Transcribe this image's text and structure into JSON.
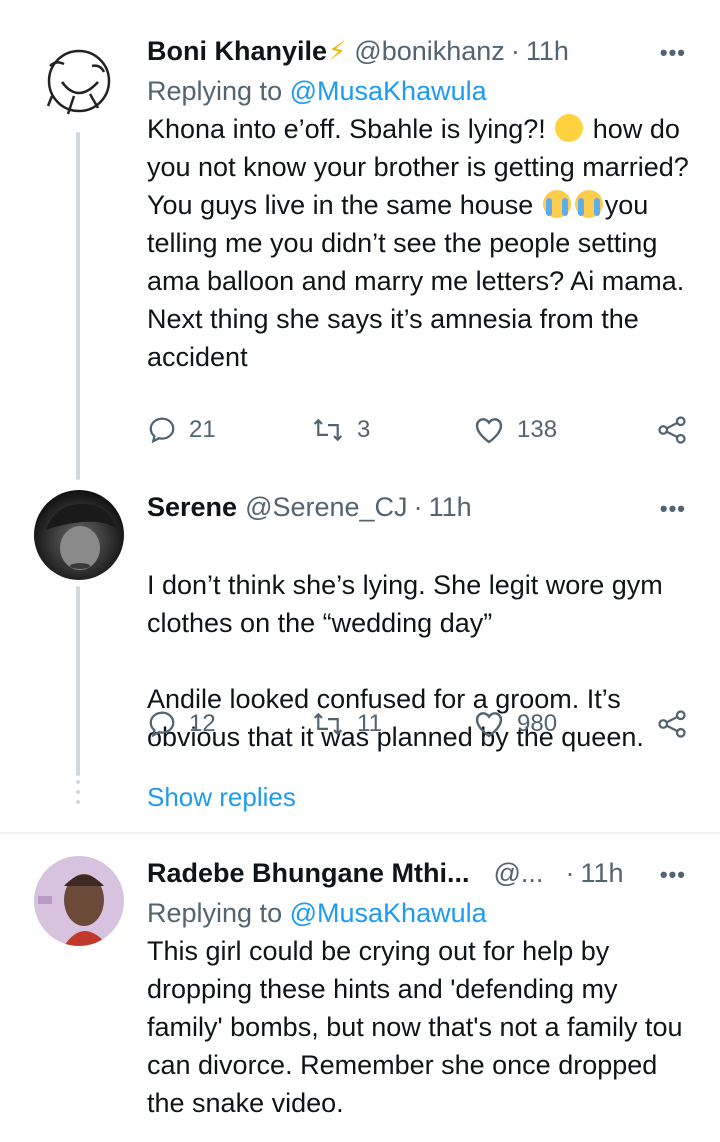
{
  "tweets": [
    {
      "name": "Boni Khanyile",
      "handle": "@bonikhanz",
      "sep": "·",
      "time": "11h",
      "replying_prefix": "Replying to",
      "replying_to": "@MusaKhawula",
      "body_parts": [
        "Khona into e’off. Sbahle is lying?! ",
        " how do you not know your brother is getting married? You guys live in the same house ",
        "you telling me you didn’t see the people setting ama balloon and marry me letters? Ai mama. Next thing she says it’s amnesia from the accident"
      ],
      "replies": "21",
      "retweets": "3",
      "likes": "138"
    },
    {
      "name": "Serene",
      "handle": "@Serene_CJ",
      "sep": "·",
      "time": "11h",
      "body_line1": "I don’t think she’s lying. She legit wore gym clothes on the “wedding day”",
      "body_line2": "Andile looked confused for a groom. It’s obvious that it was planned by the queen.",
      "replies": "12",
      "retweets": "11",
      "likes": "980"
    },
    {
      "name": "Radebe Bhungane Mthi...",
      "handle": "@...",
      "sep": "·",
      "time": "11h",
      "replying_prefix": "Replying to",
      "replying_to": "@MusaKhawula",
      "body": "This girl could be crying out for help by dropping these hints and 'defending my family' bombs, but now that's not a family tou can divorce. Remember she once dropped the snake video."
    }
  ],
  "show_replies": "Show replies",
  "icons": {
    "more": "more-icon",
    "reply": "reply-icon",
    "retweet": "retweet-icon",
    "like": "heart-icon",
    "share": "share-icon",
    "bolt": "lightning-icon"
  },
  "colors": {
    "link": "#1d9bf0",
    "muted": "#536471",
    "text": "#0f1419",
    "thread_line": "#cfd9de"
  }
}
